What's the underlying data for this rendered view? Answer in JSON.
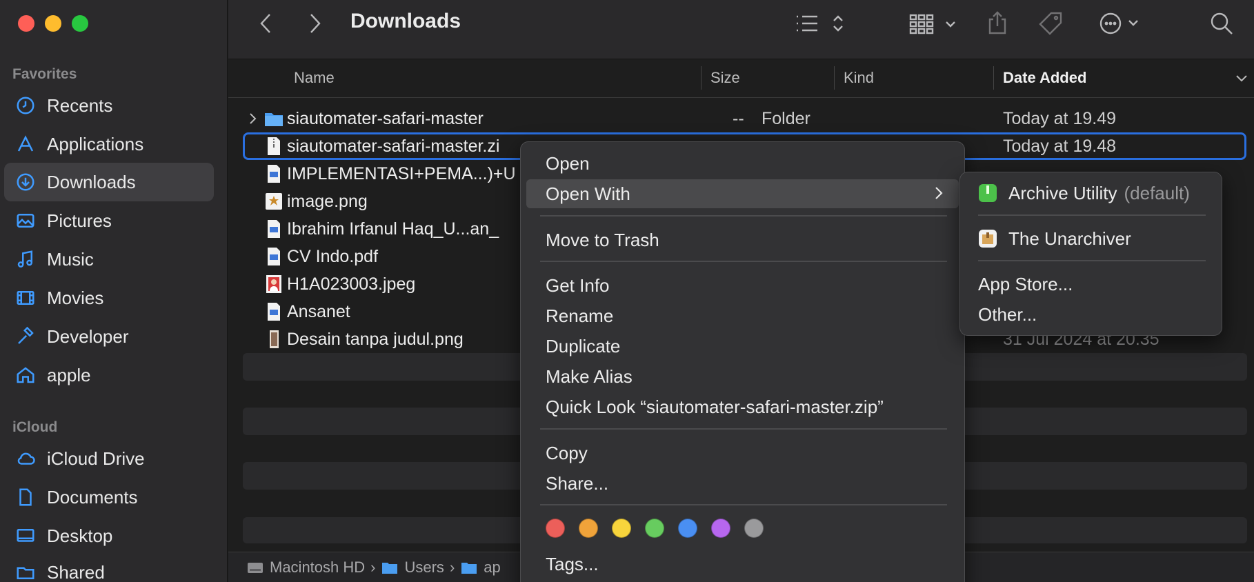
{
  "sidebar": {
    "favorites_label": "Favorites",
    "icloud_label": "iCloud",
    "items": [
      {
        "label": "Recents",
        "icon": "clock-icon"
      },
      {
        "label": "Applications",
        "icon": "applications-icon"
      },
      {
        "label": "Downloads",
        "icon": "download-icon",
        "active": true
      },
      {
        "label": "Pictures",
        "icon": "photo-icon"
      },
      {
        "label": "Music",
        "icon": "music-note-icon"
      },
      {
        "label": "Movies",
        "icon": "film-icon"
      },
      {
        "label": "Developer",
        "icon": "hammer-icon"
      },
      {
        "label": "apple",
        "icon": "home-icon"
      }
    ],
    "icloud_items": [
      {
        "label": "iCloud Drive",
        "icon": "cloud-icon"
      },
      {
        "label": "Documents",
        "icon": "document-icon"
      },
      {
        "label": "Desktop",
        "icon": "desktop-icon"
      },
      {
        "label": "Shared",
        "icon": "shared-folder-icon"
      }
    ]
  },
  "toolbar": {
    "title": "Downloads"
  },
  "columns": {
    "name": "Name",
    "size": "Size",
    "kind": "Kind",
    "date_added": "Date Added"
  },
  "files": [
    {
      "name": "siautomater-safari-master",
      "size": "--",
      "kind": "Folder",
      "date": "Today at 19.49",
      "icon": "folder-icon"
    },
    {
      "name": "siautomater-safari-master.zi",
      "size": "",
      "kind": "",
      "date": "Today at 19.48",
      "icon": "zip-icon",
      "selected": true
    },
    {
      "name": "IMPLEMENTASI+PEMA...)+U",
      "size": "",
      "kind": "",
      "date": "",
      "icon": "pdf-icon"
    },
    {
      "name": "image.png",
      "size": "",
      "kind": "",
      "date": "",
      "icon": "image-icon"
    },
    {
      "name": "Ibrahim Irfanul Haq_U...an_",
      "size": "",
      "kind": "",
      "date": "",
      "icon": "pdf-icon"
    },
    {
      "name": "CV Indo.pdf",
      "size": "",
      "kind": "",
      "date": "",
      "icon": "pdf-icon"
    },
    {
      "name": "H1A023003.jpeg",
      "size": "",
      "kind": "",
      "date": "",
      "icon": "photo-thumb-icon"
    },
    {
      "name": "Ansanet",
      "size": "",
      "kind": "",
      "date": "",
      "icon": "pdf-icon"
    },
    {
      "name": "Desain tanpa judul.png",
      "size": "",
      "kind": "",
      "date": "31 Jul 2024 at 20.35",
      "icon": "image-thumb-icon"
    }
  ],
  "pathbar": {
    "items": [
      "Macintosh HD",
      "Users",
      "ap"
    ]
  },
  "context_menu": {
    "open": "Open",
    "open_with": "Open With",
    "move_to_trash": "Move to Trash",
    "get_info": "Get Info",
    "rename": "Rename",
    "duplicate": "Duplicate",
    "make_alias": "Make Alias",
    "quick_look": "Quick Look “siautomater-safari-master.zip”",
    "copy": "Copy",
    "share": "Share...",
    "tags": "Tags...",
    "tag_colors": [
      "#ec5f5a",
      "#f0a33a",
      "#f7d43c",
      "#67cc5f",
      "#4a8ff2",
      "#b767ef",
      "#9a9a9c"
    ]
  },
  "submenu": {
    "archive_utility": "Archive Utility",
    "archive_default": "(default)",
    "unarchiver": "The Unarchiver",
    "app_store": "App Store...",
    "other": "Other..."
  }
}
